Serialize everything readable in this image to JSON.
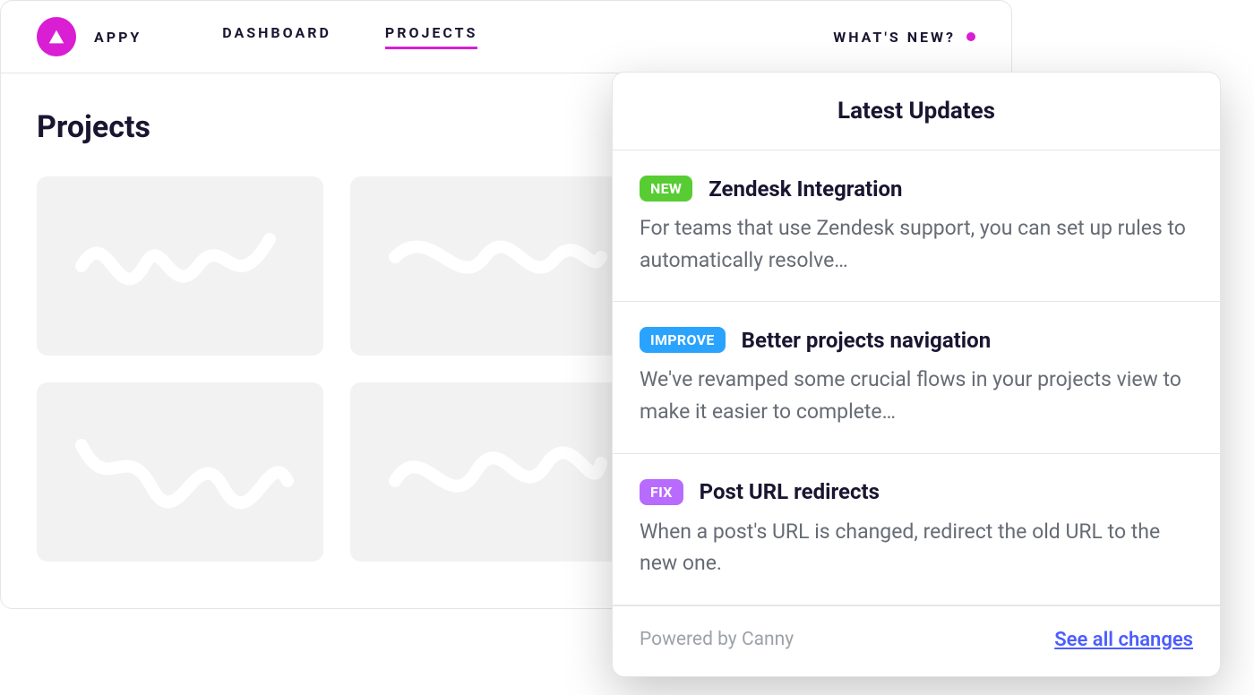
{
  "brand": "APPY",
  "nav": {
    "dashboard": "DASHBOARD",
    "projects": "PROJECTS",
    "whats_new": "WHAT'S NEW?"
  },
  "page": {
    "title": "Projects"
  },
  "updates": {
    "header": "Latest Updates",
    "items": [
      {
        "badge": "NEW",
        "badge_type": "new",
        "title": "Zendesk Integration",
        "desc": "For teams that use Zendesk support, you can set up rules to automatically resolve…"
      },
      {
        "badge": "IMPROVE",
        "badge_type": "improve",
        "title": "Better projects navigation",
        "desc": "We've revamped some crucial flows in your projects view to make it easier to complete…"
      },
      {
        "badge": "FIX",
        "badge_type": "fix",
        "title": "Post URL redirects",
        "desc": "When a post's URL is changed, redirect the old URL to the new one."
      }
    ],
    "powered_by": "Powered by Canny",
    "see_all": "See all changes"
  }
}
